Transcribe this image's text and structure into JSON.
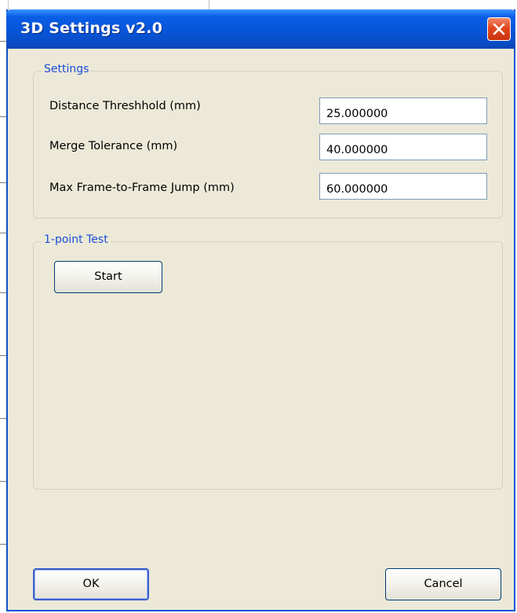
{
  "window": {
    "title": "3D Settings v2.0",
    "close_icon": "close-icon"
  },
  "settings_group": {
    "label": "Settings",
    "fields": [
      {
        "label": "Distance Threshhold (mm)",
        "value": "25.000000"
      },
      {
        "label": "Merge Tolerance (mm)",
        "value": "40.000000"
      },
      {
        "label": "Max Frame-to-Frame Jump (mm)",
        "value": "60.000000"
      }
    ]
  },
  "test_group": {
    "label": "1-point Test",
    "start_label": "Start"
  },
  "footer": {
    "ok_label": "OK",
    "cancel_label": "Cancel"
  },
  "colors": {
    "titlebar": "#0754d8",
    "window_bg": "#ece9d8",
    "group_label": "#1a4ed8",
    "close_button": "#e2461f"
  }
}
